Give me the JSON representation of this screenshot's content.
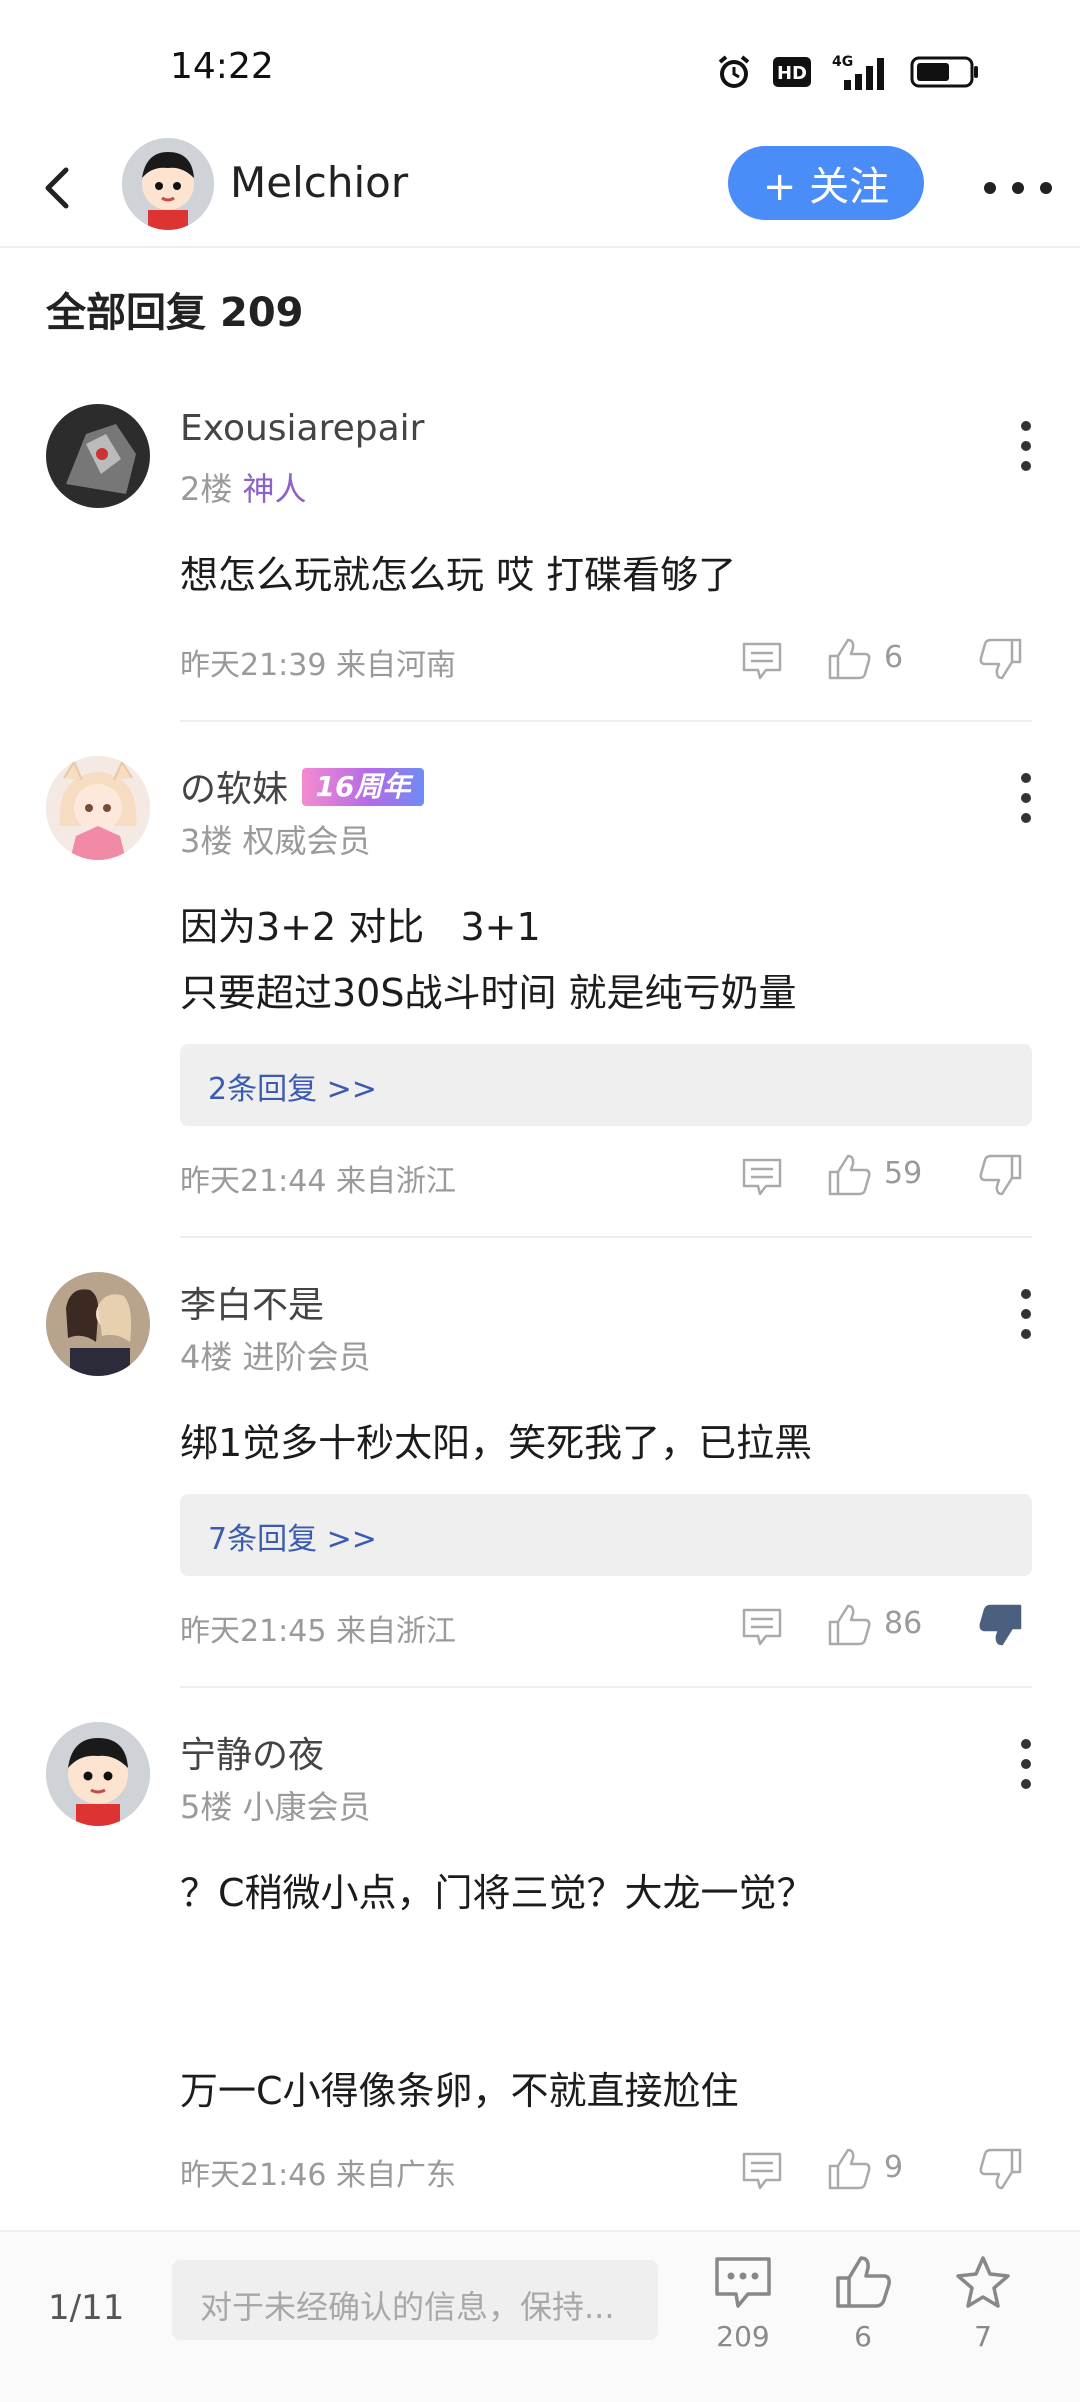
{
  "status_bar": {
    "time": "14:22",
    "network": "4G",
    "hd": "HD"
  },
  "header": {
    "author": "Melchior",
    "follow_label": "+ 关注"
  },
  "section": {
    "title": "全部回复",
    "count": "209"
  },
  "posts": [
    {
      "username": "Exousiarepair",
      "floor": "2楼",
      "rank": "神人",
      "text": "想怎么玩就怎么玩 哎 打碟看够了",
      "time_location": "昨天21:39 来自河南",
      "likes": "6"
    },
    {
      "username": "の软妹",
      "badge": "16周年",
      "floor": "3楼",
      "rank": "权威会员",
      "text": "因为3+2 对比   3+1\n只要超过30S战斗时间 就是纯亏奶量",
      "replies_label": "2条回复 >>",
      "time_location": "昨天21:44 来自浙江",
      "likes": "59"
    },
    {
      "username": "李白不是",
      "floor": "4楼",
      "rank": "进阶会员",
      "text": "绑1觉多十秒太阳，笑死我了，已拉黑",
      "replies_label": "7条回复 >>",
      "time_location": "昨天21:45 来自浙江",
      "likes": "86"
    },
    {
      "username": "宁静の夜",
      "floor": "5楼",
      "rank": "小康会员",
      "text": "？C稍微小点，门将三觉？大龙一觉？\n\n\n万一C小得像条卵，不就直接尬住",
      "time_location": "昨天21:46 来自广东",
      "likes": "9"
    }
  ],
  "bottom_bar": {
    "page": "1/11",
    "input_placeholder": "对于未经确认的信息，保持...",
    "comment_count": "209",
    "like_count": "6",
    "favorite_count": "7"
  },
  "colors": {
    "accent": "#4a8df8",
    "purple_rank": "#8b62c9",
    "reply_link": "#3b5bb0"
  }
}
